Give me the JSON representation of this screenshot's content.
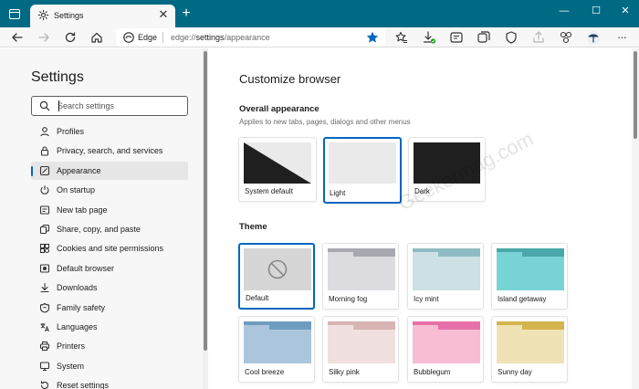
{
  "browser": {
    "tab_title": "Settings",
    "tab_close": "✕",
    "new_tab": "+",
    "window_controls": [
      "—",
      "☐",
      "✕"
    ],
    "address_label": "Edge",
    "address_url_host": "edge://",
    "address_url_path": "settings",
    "address_url_rest": "/appearance",
    "accent": "#0067c0",
    "tabbar_color": "#006a85"
  },
  "sidebar": {
    "title": "Settings",
    "search_placeholder": "Search settings",
    "items": [
      {
        "label": "Profiles",
        "icon": "profile-icon"
      },
      {
        "label": "Privacy, search, and services",
        "icon": "lock-icon"
      },
      {
        "label": "Appearance",
        "icon": "appearance-icon",
        "active": true
      },
      {
        "label": "On startup",
        "icon": "power-icon"
      },
      {
        "label": "New tab page",
        "icon": "new-tab-page-icon"
      },
      {
        "label": "Share, copy, and paste",
        "icon": "share-icon"
      },
      {
        "label": "Cookies and site permissions",
        "icon": "permissions-icon"
      },
      {
        "label": "Default browser",
        "icon": "default-browser-icon"
      },
      {
        "label": "Downloads",
        "icon": "download-icon"
      },
      {
        "label": "Family safety",
        "icon": "family-icon"
      },
      {
        "label": "Languages",
        "icon": "language-icon"
      },
      {
        "label": "Printers",
        "icon": "printer-icon"
      },
      {
        "label": "System",
        "icon": "system-icon"
      },
      {
        "label": "Reset settings",
        "icon": "reset-icon"
      }
    ]
  },
  "main": {
    "title": "Customize browser",
    "overall": {
      "heading": "Overall appearance",
      "subtitle": "Applies to new tabs, pages, dialogs and other menus",
      "options": [
        {
          "label": "System default"
        },
        {
          "label": "Light",
          "selected": true
        },
        {
          "label": "Dark"
        }
      ]
    },
    "theme": {
      "heading": "Theme",
      "options": [
        {
          "label": "Default",
          "selected": true,
          "tab": "#ffffff",
          "body": "#d6d6d6"
        },
        {
          "label": "Morning fog",
          "tab": "#a8a8b0",
          "body": "#dcdce0"
        },
        {
          "label": "Icy mint",
          "tab": "#8fbcc4",
          "body": "#cde0e4"
        },
        {
          "label": "Island getaway",
          "tab": "#4aa8a8",
          "body": "#78d4d4"
        },
        {
          "label": "Cool breeze",
          "tab": "#6e9cbf",
          "body": "#abc6dc"
        },
        {
          "label": "Silky pink",
          "tab": "#d8b4b4",
          "body": "#f1e0e0"
        },
        {
          "label": "Bubblegum",
          "tab": "#e870a8",
          "body": "#f8bcd4"
        },
        {
          "label": "Sunny day",
          "tab": "#d4b44c",
          "body": "#efe2b4"
        }
      ]
    },
    "watermark": "Geekermag.com"
  }
}
